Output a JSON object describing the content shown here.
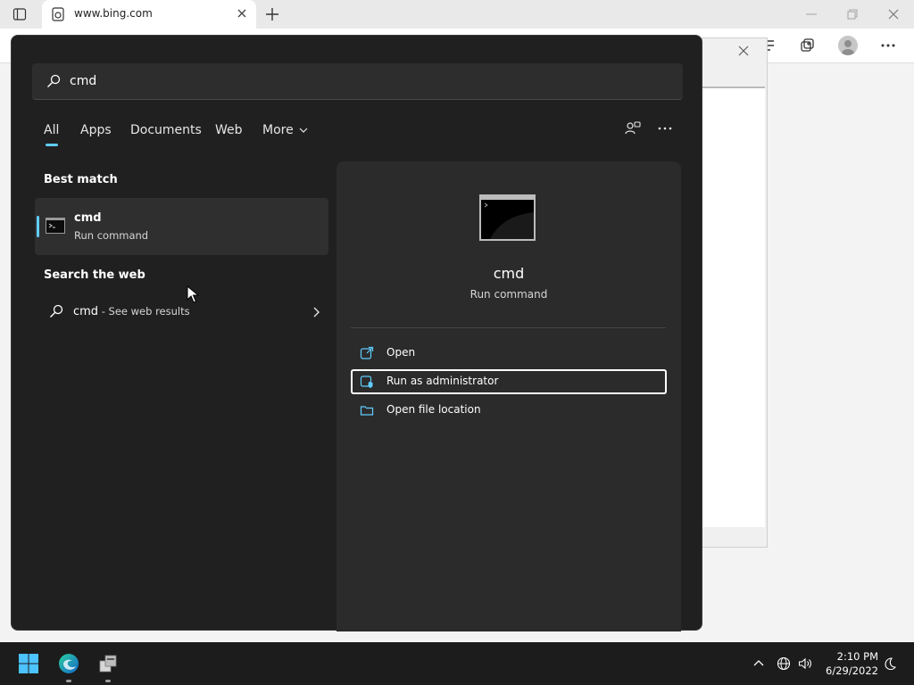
{
  "browser": {
    "tab_title": "www.bing.com"
  },
  "search": {
    "query": "cmd",
    "tabs": [
      "All",
      "Apps",
      "Documents",
      "Web",
      "More"
    ],
    "active_tab": "All",
    "best_match_heading": "Best match",
    "best_match": {
      "title": "cmd",
      "subtitle": "Run command"
    },
    "web_heading": "Search the web",
    "web_result": {
      "query": "cmd",
      "suffix": " - See web results"
    }
  },
  "details": {
    "title": "cmd",
    "subtitle": "Run command",
    "actions": {
      "open": "Open",
      "run_as_admin": "Run as administrator",
      "open_location": "Open file location"
    },
    "focused_action": "Run as administrator"
  },
  "taskbar": {
    "time": "2:10 PM",
    "date": "6/29/2022"
  },
  "colors": {
    "accent": "#60cdff",
    "panel_bg": "#202020",
    "details_bg": "#2b2b2b",
    "taskbar_bg": "#1c1c1c"
  },
  "icons": [
    "tab-actions-icon",
    "favicon-icon",
    "close-icon",
    "plus-icon",
    "minimize-icon",
    "restore-icon",
    "search-icon",
    "chevron-down-icon",
    "people-icon",
    "more-icon",
    "cmd-icon",
    "chevron-right-icon",
    "open-icon",
    "shield-icon",
    "folder-icon",
    "windows-logo-icon",
    "edge-icon",
    "app-icon",
    "chevron-up-icon",
    "globe-icon",
    "volume-icon",
    "moon-icon"
  ]
}
